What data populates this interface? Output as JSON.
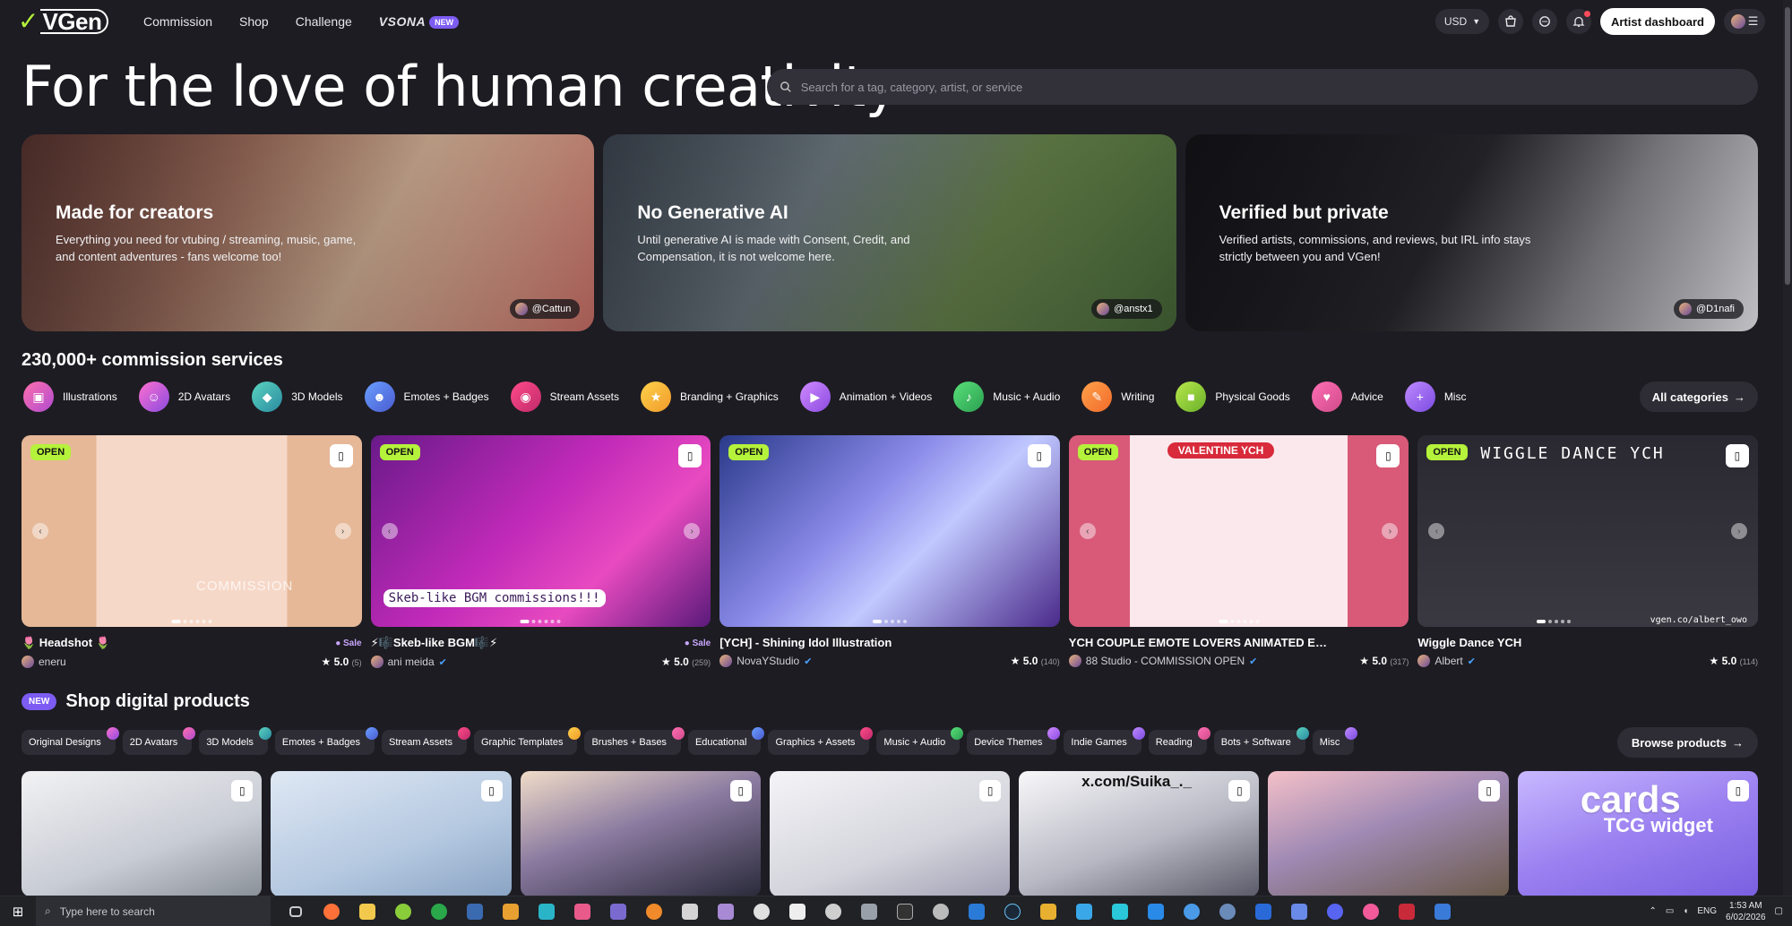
{
  "nav": {
    "logo": "VGen",
    "links": [
      "Commission",
      "Shop",
      "Challenge"
    ],
    "vsona": "VSONA",
    "vsona_badge": "NEW",
    "currency": "USD",
    "artist_dashboard": "Artist dashboard"
  },
  "hero": {
    "title": "For the love of human creativity",
    "search_placeholder": "Search for a tag, category, artist, or service"
  },
  "features": [
    {
      "title": "Made for creators",
      "text": "Everything you need for vtubing / streaming, music, game, and content adventures - fans welcome too!",
      "credit": "@Cattun"
    },
    {
      "title": "No Generative AI",
      "text": "Until generative AI is made with Consent, Credit, and Compensation, it is not welcome here.",
      "credit": "@anstx1"
    },
    {
      "title": "Verified but private",
      "text": "Verified artists, commissions, and reviews, but IRL info stays strictly between you and VGen!",
      "credit": "@D1nafi"
    }
  ],
  "commissions": {
    "heading": "230,000+ commission services",
    "categories": [
      "Illustrations",
      "2D Avatars",
      "3D Models",
      "Emotes + Badges",
      "Stream Assets",
      "Branding + Graphics",
      "Animation + Videos",
      "Music + Audio",
      "Writing",
      "Physical Goods",
      "Advice",
      "Misc"
    ],
    "all_categories": "All categories",
    "cards": [
      {
        "badge": "OPEN",
        "title": "🌷 Headshot 🌷",
        "sale": "Sale",
        "artist": "eneru",
        "rating": "5.0",
        "reviews": "(5)",
        "overlay": "COMMISSION"
      },
      {
        "badge": "OPEN",
        "title": "⚡🎼Skeb-like BGM🎼⚡",
        "sale": "Sale",
        "artist": "ani meida",
        "rating": "5.0",
        "reviews": "(259)",
        "overlay": "Skeb-like BGM commissions!!!"
      },
      {
        "badge": "OPEN",
        "title": "[YCH] - Shining Idol Illustration",
        "sale": "",
        "artist": "NovaYStudio",
        "rating": "5.0",
        "reviews": "(140)",
        "overlay": ""
      },
      {
        "badge": "OPEN",
        "title": "YCH COUPLE EMOTE LOVERS ANIMATED EM...",
        "sale": "",
        "artist": "88 Studio - COMMISSION OPEN",
        "rating": "5.0",
        "reviews": "(317)",
        "overlay": "VALENTINE YCH"
      },
      {
        "badge": "OPEN",
        "title": "Wiggle Dance YCH",
        "sale": "",
        "artist": "Albert",
        "rating": "5.0",
        "reviews": "(114)",
        "overlay": "WIGGLE DANCE YCH",
        "overlay2": "vgen.co/albert_owo"
      }
    ]
  },
  "shop": {
    "badge": "NEW",
    "heading": "Shop digital products",
    "chips": [
      "Original Designs",
      "2D Avatars",
      "3D Models",
      "Emotes + Badges",
      "Stream Assets",
      "Graphic Templates",
      "Brushes + Bases",
      "Educational",
      "Graphics + Assets",
      "Music + Audio",
      "Device Themes",
      "Indie Games",
      "Reading",
      "Bots + Software",
      "Misc"
    ],
    "browse": "Browse products",
    "card_text": {
      "watermark": "x.com/Suika_._",
      "cards": "cards",
      "tcg": "TCG widget"
    }
  },
  "taskbar": {
    "search_placeholder": "Type here to search",
    "lang": "ENG",
    "time": "1:53 AM",
    "date": "6/02/2026"
  },
  "colors": {
    "accent": "#b5f23b",
    "new_badge": "#7c5cf2",
    "background": "#1d1c22"
  }
}
